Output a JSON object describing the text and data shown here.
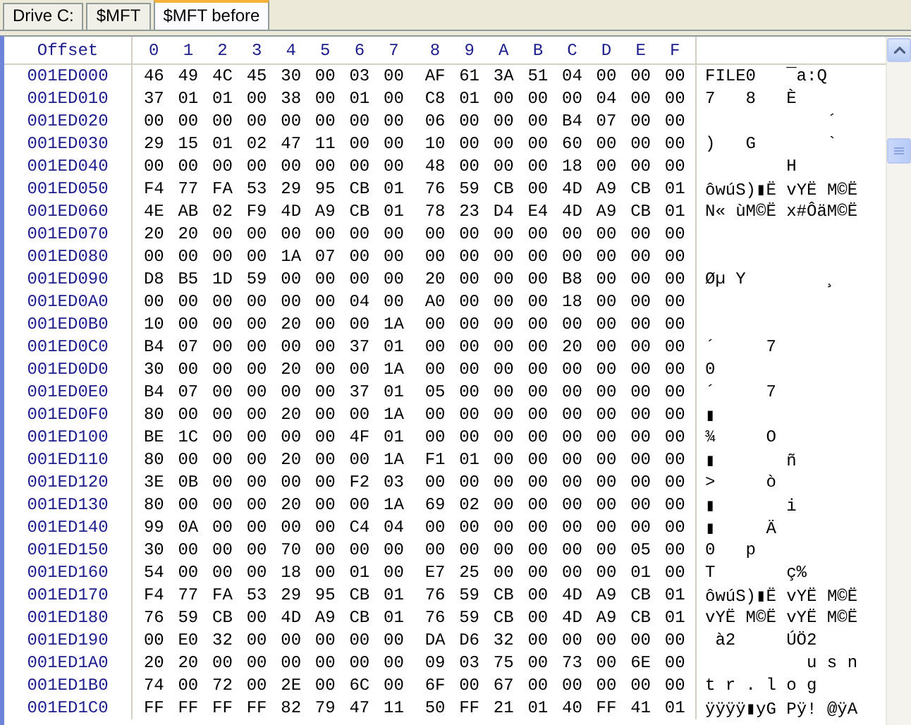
{
  "tabs": [
    {
      "label": "Drive C:",
      "selected": false
    },
    {
      "label": "$MFT",
      "selected": false
    },
    {
      "label": "$MFT before",
      "selected": true
    }
  ],
  "table": {
    "columns": [
      "Offset",
      "0",
      "1",
      "2",
      "3",
      "4",
      "5",
      "6",
      "7",
      "8",
      "9",
      "A",
      "B",
      "C",
      "D",
      "E",
      "F"
    ],
    "rows": [
      {
        "offset": "001ED000",
        "bytes": [
          "46",
          "49",
          "4C",
          "45",
          "30",
          "00",
          "03",
          "00",
          "AF",
          "61",
          "3A",
          "51",
          "04",
          "00",
          "00",
          "00"
        ],
        "ascii": "FILE0   ¯a:Q"
      },
      {
        "offset": "001ED010",
        "bytes": [
          "37",
          "01",
          "01",
          "00",
          "38",
          "00",
          "01",
          "00",
          "C8",
          "01",
          "00",
          "00",
          "00",
          "04",
          "00",
          "00"
        ],
        "ascii": "7   8   È"
      },
      {
        "offset": "001ED020",
        "bytes": [
          "00",
          "00",
          "00",
          "00",
          "00",
          "00",
          "00",
          "00",
          "06",
          "00",
          "00",
          "00",
          "B4",
          "07",
          "00",
          "00"
        ],
        "ascii": "            ´"
      },
      {
        "offset": "001ED030",
        "bytes": [
          "29",
          "15",
          "01",
          "02",
          "47",
          "11",
          "00",
          "00",
          "10",
          "00",
          "00",
          "00",
          "60",
          "00",
          "00",
          "00"
        ],
        "ascii": ")   G       `"
      },
      {
        "offset": "001ED040",
        "bytes": [
          "00",
          "00",
          "00",
          "00",
          "00",
          "00",
          "00",
          "00",
          "48",
          "00",
          "00",
          "00",
          "18",
          "00",
          "00",
          "00"
        ],
        "ascii": "        H"
      },
      {
        "offset": "001ED050",
        "bytes": [
          "F4",
          "77",
          "FA",
          "53",
          "29",
          "95",
          "CB",
          "01",
          "76",
          "59",
          "CB",
          "00",
          "4D",
          "A9",
          "CB",
          "01"
        ],
        "ascii": "ôwúS)▮Ë vYË M©Ë"
      },
      {
        "offset": "001ED060",
        "bytes": [
          "4E",
          "AB",
          "02",
          "F9",
          "4D",
          "A9",
          "CB",
          "01",
          "78",
          "23",
          "D4",
          "E4",
          "4D",
          "A9",
          "CB",
          "01"
        ],
        "ascii": "N« ùM©Ë x#ÔäM©Ë"
      },
      {
        "offset": "001ED070",
        "bytes": [
          "20",
          "20",
          "00",
          "00",
          "00",
          "00",
          "00",
          "00",
          "00",
          "00",
          "00",
          "00",
          "00",
          "00",
          "00",
          "00"
        ]
      },
      {
        "offset": "001ED080",
        "bytes": [
          "00",
          "00",
          "00",
          "00",
          "1A",
          "07",
          "00",
          "00",
          "00",
          "00",
          "00",
          "00",
          "00",
          "00",
          "00",
          "00"
        ]
      },
      {
        "offset": "001ED090",
        "bytes": [
          "D8",
          "B5",
          "1D",
          "59",
          "00",
          "00",
          "00",
          "00",
          "20",
          "00",
          "00",
          "00",
          "B8",
          "00",
          "00",
          "00"
        ],
        "ascii": "Øµ Y        ¸"
      },
      {
        "offset": "001ED0A0",
        "bytes": [
          "00",
          "00",
          "00",
          "00",
          "00",
          "00",
          "04",
          "00",
          "A0",
          "00",
          "00",
          "00",
          "18",
          "00",
          "00",
          "00"
        ]
      },
      {
        "offset": "001ED0B0",
        "bytes": [
          "10",
          "00",
          "00",
          "00",
          "20",
          "00",
          "00",
          "1A",
          "00",
          "00",
          "00",
          "00",
          "00",
          "00",
          "00",
          "00"
        ]
      },
      {
        "offset": "001ED0C0",
        "bytes": [
          "B4",
          "07",
          "00",
          "00",
          "00",
          "00",
          "37",
          "01",
          "00",
          "00",
          "00",
          "00",
          "20",
          "00",
          "00",
          "00"
        ],
        "ascii": "´     7"
      },
      {
        "offset": "001ED0D0",
        "bytes": [
          "30",
          "00",
          "00",
          "00",
          "20",
          "00",
          "00",
          "1A",
          "00",
          "00",
          "00",
          "00",
          "00",
          "00",
          "00",
          "00"
        ],
        "ascii": "0"
      },
      {
        "offset": "001ED0E0",
        "bytes": [
          "B4",
          "07",
          "00",
          "00",
          "00",
          "00",
          "37",
          "01",
          "05",
          "00",
          "00",
          "00",
          "00",
          "00",
          "00",
          "00"
        ],
        "ascii": "´     7"
      },
      {
        "offset": "001ED0F0",
        "bytes": [
          "80",
          "00",
          "00",
          "00",
          "20",
          "00",
          "00",
          "1A",
          "00",
          "00",
          "00",
          "00",
          "00",
          "00",
          "00",
          "00"
        ],
        "ascii": "▮"
      },
      {
        "offset": "001ED100",
        "bytes": [
          "BE",
          "1C",
          "00",
          "00",
          "00",
          "00",
          "4F",
          "01",
          "00",
          "00",
          "00",
          "00",
          "00",
          "00",
          "00",
          "00"
        ],
        "ascii": "¾     O"
      },
      {
        "offset": "001ED110",
        "bytes": [
          "80",
          "00",
          "00",
          "00",
          "20",
          "00",
          "00",
          "1A",
          "F1",
          "01",
          "00",
          "00",
          "00",
          "00",
          "00",
          "00"
        ],
        "ascii": "▮       ñ"
      },
      {
        "offset": "001ED120",
        "bytes": [
          "3E",
          "0B",
          "00",
          "00",
          "00",
          "00",
          "F2",
          "03",
          "00",
          "00",
          "00",
          "00",
          "00",
          "00",
          "00",
          "00"
        ],
        "ascii": ">     ò"
      },
      {
        "offset": "001ED130",
        "bytes": [
          "80",
          "00",
          "00",
          "00",
          "20",
          "00",
          "00",
          "1A",
          "69",
          "02",
          "00",
          "00",
          "00",
          "00",
          "00",
          "00"
        ],
        "ascii": "▮       i"
      },
      {
        "offset": "001ED140",
        "bytes": [
          "99",
          "0A",
          "00",
          "00",
          "00",
          "00",
          "C4",
          "04",
          "00",
          "00",
          "00",
          "00",
          "00",
          "00",
          "00",
          "00"
        ],
        "ascii": "▮     Ä"
      },
      {
        "offset": "001ED150",
        "bytes": [
          "30",
          "00",
          "00",
          "00",
          "70",
          "00",
          "00",
          "00",
          "00",
          "00",
          "00",
          "00",
          "00",
          "00",
          "05",
          "00"
        ],
        "ascii": "0   p"
      },
      {
        "offset": "001ED160",
        "bytes": [
          "54",
          "00",
          "00",
          "00",
          "18",
          "00",
          "01",
          "00",
          "E7",
          "25",
          "00",
          "00",
          "00",
          "00",
          "01",
          "00"
        ],
        "ascii": "T       ç%"
      },
      {
        "offset": "001ED170",
        "bytes": [
          "F4",
          "77",
          "FA",
          "53",
          "29",
          "95",
          "CB",
          "01",
          "76",
          "59",
          "CB",
          "00",
          "4D",
          "A9",
          "CB",
          "01"
        ],
        "ascii": "ôwúS)▮Ë vYË M©Ë"
      },
      {
        "offset": "001ED180",
        "bytes": [
          "76",
          "59",
          "CB",
          "00",
          "4D",
          "A9",
          "CB",
          "01",
          "76",
          "59",
          "CB",
          "00",
          "4D",
          "A9",
          "CB",
          "01"
        ],
        "ascii": "vYË M©Ë vYË M©Ë"
      },
      {
        "offset": "001ED190",
        "bytes": [
          "00",
          "E0",
          "32",
          "00",
          "00",
          "00",
          "00",
          "00",
          "DA",
          "D6",
          "32",
          "00",
          "00",
          "00",
          "00",
          "00"
        ],
        "ascii": " à2     ÚÖ2"
      },
      {
        "offset": "001ED1A0",
        "bytes": [
          "20",
          "20",
          "00",
          "00",
          "00",
          "00",
          "00",
          "00",
          "09",
          "03",
          "75",
          "00",
          "73",
          "00",
          "6E",
          "00"
        ],
        "ascii": "          u s n"
      },
      {
        "offset": "001ED1B0",
        "bytes": [
          "74",
          "00",
          "72",
          "00",
          "2E",
          "00",
          "6C",
          "00",
          "6F",
          "00",
          "67",
          "00",
          "00",
          "00",
          "00",
          "00"
        ],
        "ascii": "t r . l o g"
      },
      {
        "offset": "001ED1C0",
        "bytes": [
          "FF",
          "FF",
          "FF",
          "FF",
          "82",
          "79",
          "47",
          "11",
          "50",
          "FF",
          "21",
          "01",
          "40",
          "FF",
          "41",
          "01"
        ],
        "ascii": "ÿÿÿÿ▮yG Pÿ! @ÿA"
      }
    ]
  }
}
